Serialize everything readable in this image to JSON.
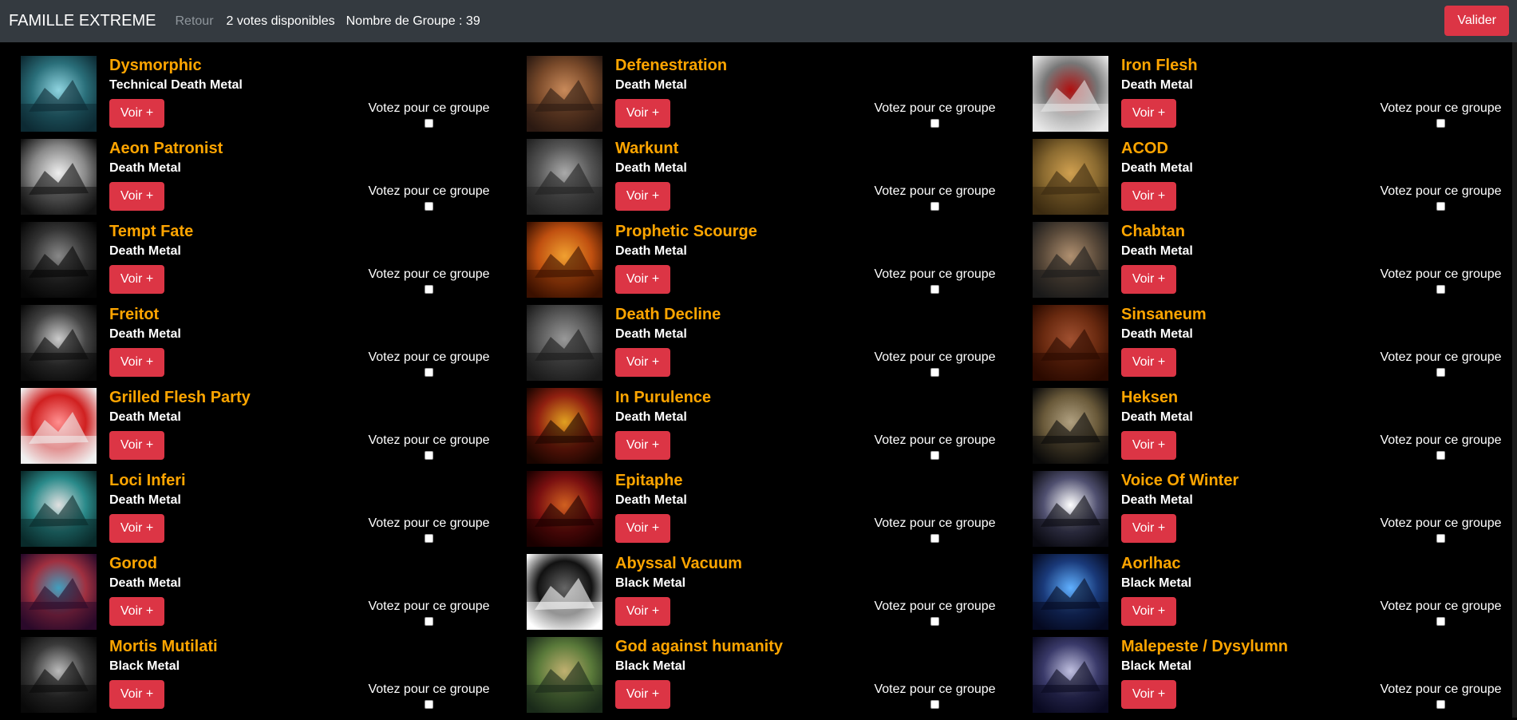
{
  "nav": {
    "brand": "FAMILLE EXTREME",
    "back": "Retour",
    "votes": "2 votes disponibles",
    "group_count": "Nombre de Groupe : 39",
    "validate": "Valider"
  },
  "card_text": {
    "voir": "Voir +",
    "vote": "Votez pour ce groupe"
  },
  "groups": [
    {
      "name": "Dysmorphic",
      "genre": "Technical Death Metal"
    },
    {
      "name": "Defenestration",
      "genre": "Death Metal"
    },
    {
      "name": "Iron Flesh",
      "genre": "Death Metal"
    },
    {
      "name": "Aeon Patronist",
      "genre": "Death Metal"
    },
    {
      "name": "Warkunt",
      "genre": "Death Metal"
    },
    {
      "name": "ACOD",
      "genre": "Death Metal"
    },
    {
      "name": "Tempt Fate",
      "genre": "Death Metal"
    },
    {
      "name": "Prophetic Scourge",
      "genre": "Death Metal"
    },
    {
      "name": "Chabtan",
      "genre": "Death Metal"
    },
    {
      "name": "Freitot",
      "genre": "Death Metal"
    },
    {
      "name": "Death Decline",
      "genre": "Death Metal"
    },
    {
      "name": "Sinsaneum",
      "genre": "Death Metal"
    },
    {
      "name": "Grilled Flesh Party",
      "genre": "Death Metal"
    },
    {
      "name": "In Purulence",
      "genre": "Death Metal"
    },
    {
      "name": "Heksen",
      "genre": "Death Metal"
    },
    {
      "name": "Loci Inferi",
      "genre": "Death Metal"
    },
    {
      "name": "Epitaphe",
      "genre": "Death Metal"
    },
    {
      "name": "Voice Of Winter",
      "genre": "Death Metal"
    },
    {
      "name": "Gorod",
      "genre": "Death Metal"
    },
    {
      "name": "Abyssal Vacuum",
      "genre": "Black Metal"
    },
    {
      "name": "Aorlhac",
      "genre": "Black Metal"
    },
    {
      "name": "Mortis Mutilati",
      "genre": "Black Metal"
    },
    {
      "name": "God against humanity",
      "genre": "Black Metal"
    },
    {
      "name": "Malepeste / Dysylumn",
      "genre": "Black Metal"
    }
  ],
  "colors": {
    "accent": "#dc3545",
    "band_name": "#ffa500",
    "navbar": "#343a40",
    "background": "#000000"
  }
}
